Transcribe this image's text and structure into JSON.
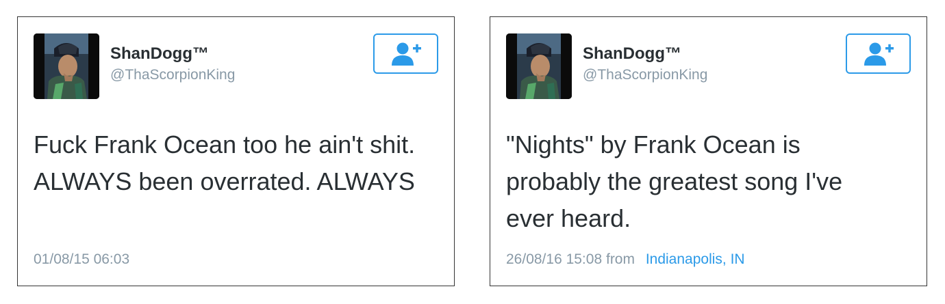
{
  "tweets": [
    {
      "author_name": "ShanDogg™",
      "author_handle": "@ThaScorpionKing",
      "text": "Fuck Frank Ocean too he ain't shit. ALWAYS been overrated. ALWAYS",
      "timestamp": "01/08/15 06:03"
    },
    {
      "author_name": "ShanDogg™",
      "author_handle": "@ThaScorpionKing",
      "text": "\"Nights\" by Frank Ocean is probably the greatest song I've ever heard.",
      "timestamp": "26/08/16 15:08",
      "from_label": "from",
      "location": "Indianapolis, IN"
    }
  ],
  "icons": {
    "follow": "add-user-icon"
  },
  "colors": {
    "accent": "#2b9ae8",
    "text": "#292f33",
    "muted": "#8899a6",
    "border": "#333333"
  }
}
